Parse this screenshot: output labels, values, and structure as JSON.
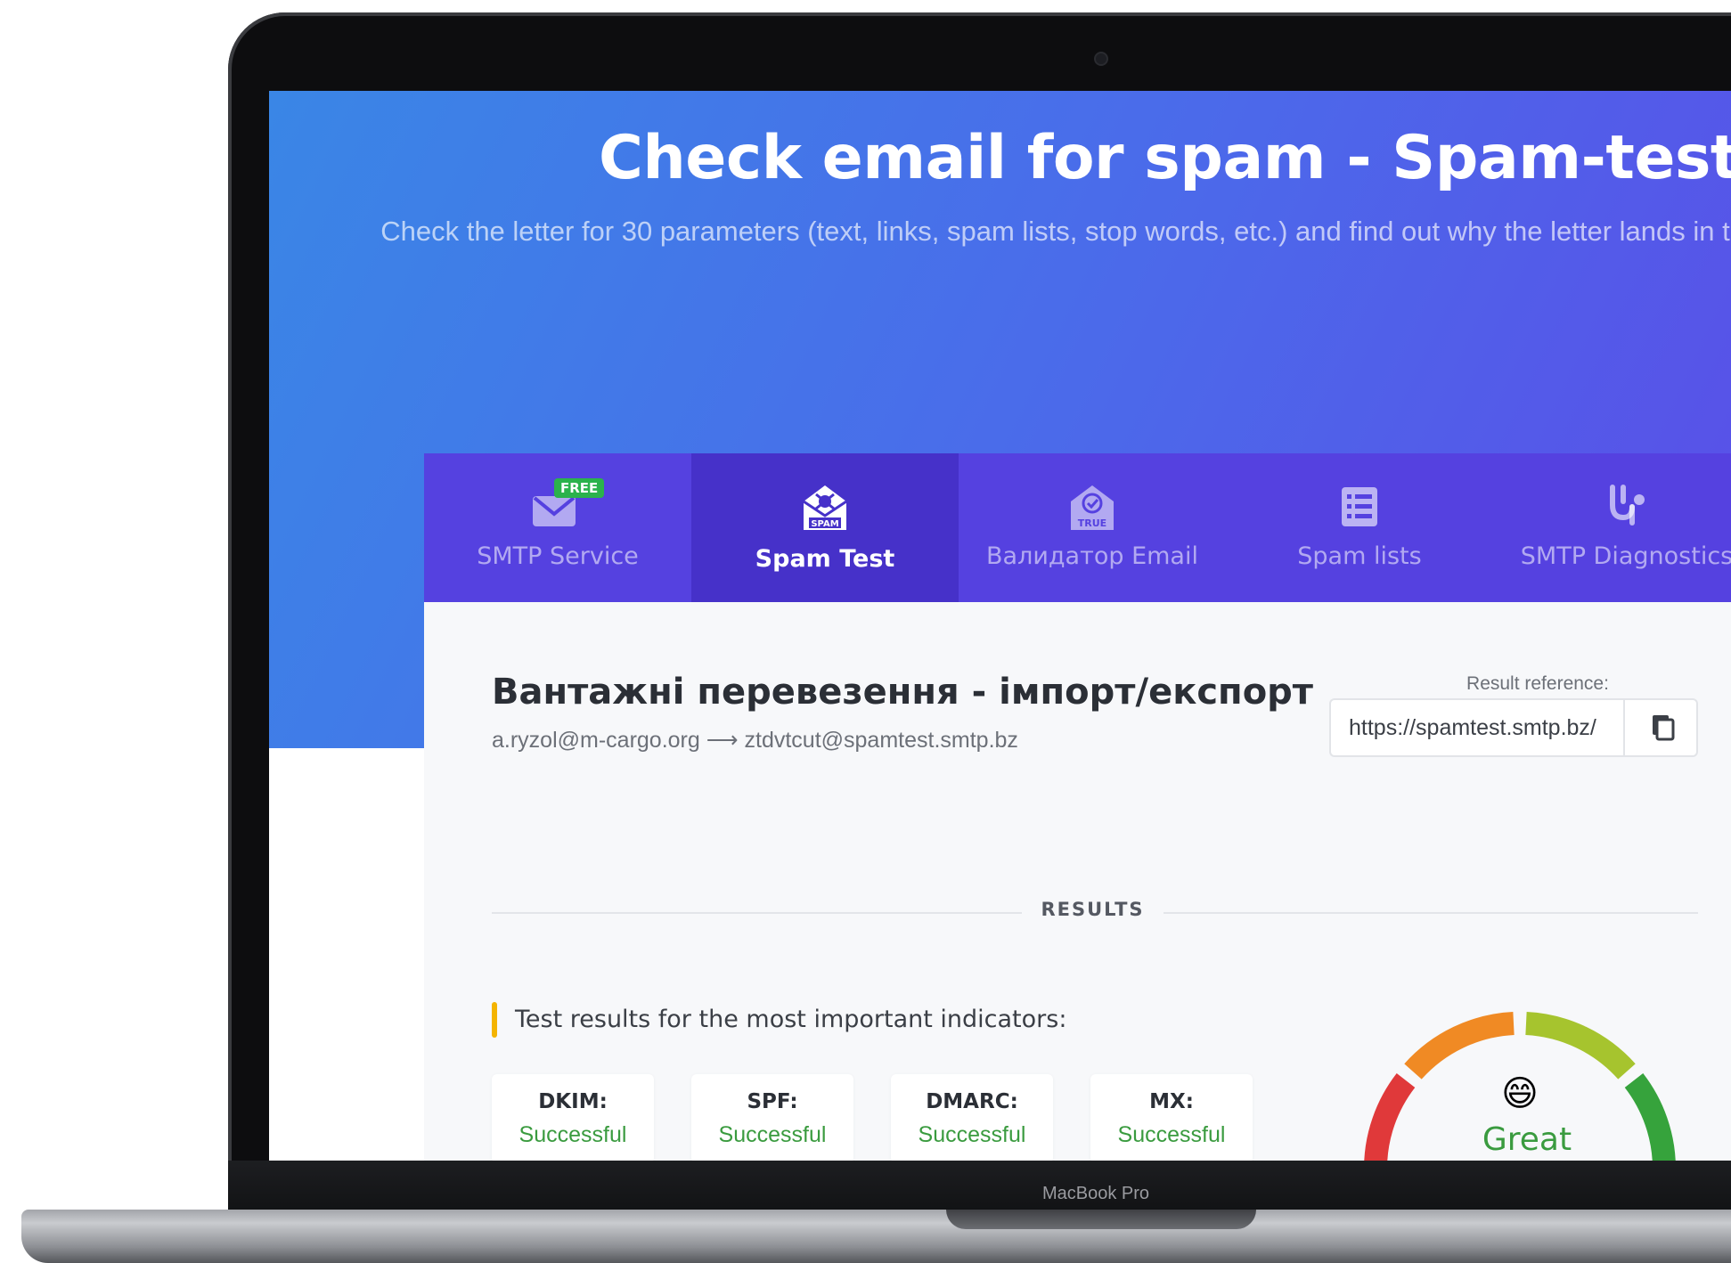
{
  "device": {
    "label": "MacBook Pro"
  },
  "hero": {
    "title": "Check email for spam - Spam-test newsletter",
    "subtitle": "Check the letter for 30 parameters (text, links, spam lists, stop words, etc.) and find out why the letter lands in the spam folder"
  },
  "tabs": [
    {
      "label": "SMTP Service",
      "icon": "envelope-icon",
      "badge": "FREE",
      "active": false
    },
    {
      "label": "Spam Test",
      "icon": "spam-envelope-icon",
      "badge": "SPAM",
      "active": true
    },
    {
      "label": "Валидатор Email",
      "icon": "validator-icon",
      "badge": "TRUE",
      "active": false
    },
    {
      "label": "Spam lists",
      "icon": "list-icon",
      "active": false
    },
    {
      "label": "SMTP Diagnostics",
      "icon": "stethoscope-icon",
      "active": false
    }
  ],
  "message": {
    "subject": "Вантажні перевезення - імпорт/експорт",
    "addresses": "a.ryzol@m-cargo.org ⟶ ztdvtcut@spamtest.smtp.bz"
  },
  "reference": {
    "label": "Result reference:",
    "value": "https://spamtest.smtp.bz/"
  },
  "results": {
    "section_label": "RESULTS",
    "important_label": "Test results for the most important indicators:",
    "indicators": [
      {
        "name": "DKIM:",
        "status": "Successful"
      },
      {
        "name": "SPF:",
        "status": "Successful"
      },
      {
        "name": "DMARC:",
        "status": "Successful"
      },
      {
        "name": "MX:",
        "status": "Successful"
      }
    ],
    "gauge": {
      "label": "Great",
      "emoji": "😄"
    }
  },
  "colors": {
    "tab_bar": "#5541e0",
    "tab_active": "#4631c9",
    "success": "#3a9b3f",
    "accent_bar": "#f4b400"
  }
}
